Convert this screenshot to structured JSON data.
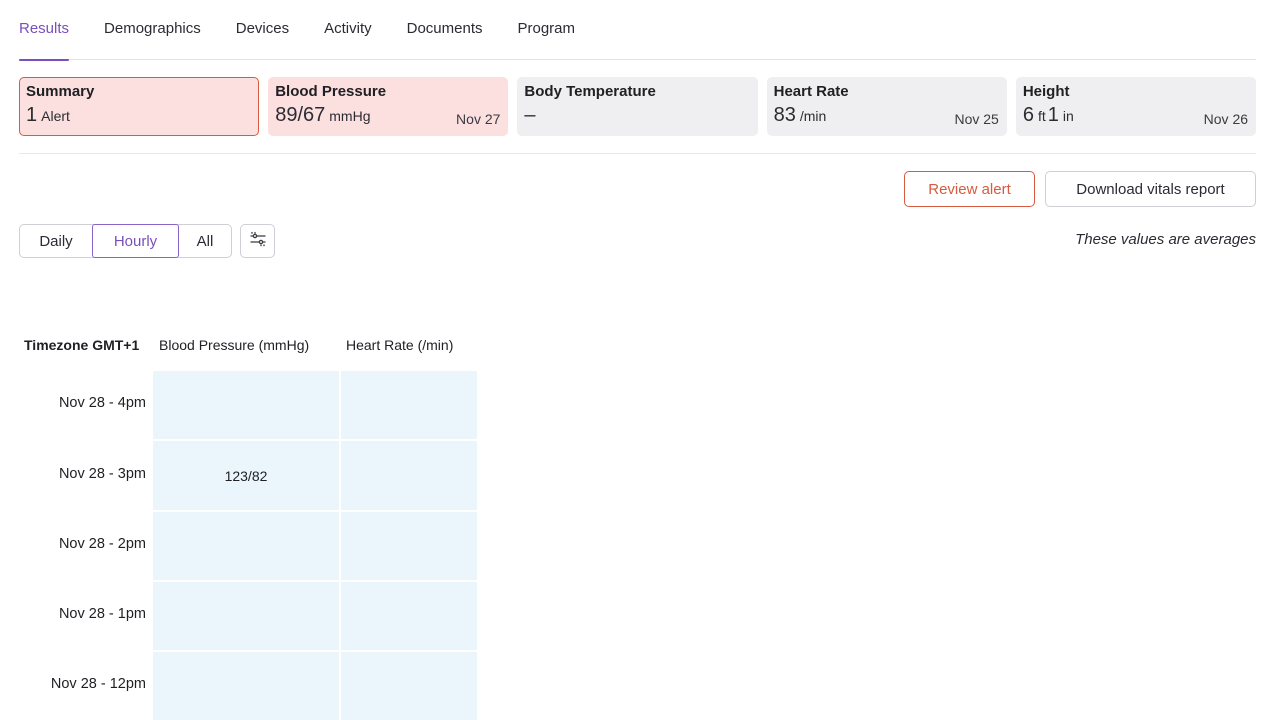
{
  "tabs": [
    "Results",
    "Demographics",
    "Devices",
    "Activity",
    "Documents",
    "Program"
  ],
  "active_tab": "Results",
  "cards": {
    "summary": {
      "title": "Summary",
      "value": "1",
      "unit": "Alert"
    },
    "blood_pressure": {
      "title": "Blood Pressure",
      "value": "89/67",
      "unit": "mmHg",
      "date": "Nov 27"
    },
    "body_temperature": {
      "title": "Body Temperature",
      "value": "–"
    },
    "heart_rate": {
      "title": "Heart Rate",
      "value": "83",
      "unit": "/min",
      "date": "Nov 25"
    },
    "height": {
      "title": "Height",
      "value_ft": "6",
      "unit_ft": "ft",
      "value_in": "1",
      "unit_in": "in",
      "date": "Nov 26"
    }
  },
  "actions": {
    "review": "Review alert",
    "download": "Download vitals report"
  },
  "segments": {
    "daily": "Daily",
    "hourly": "Hourly",
    "all": "All",
    "selected": "Hourly"
  },
  "filter_icon": "sliders-icon",
  "note": "These values are averages",
  "table": {
    "headers": {
      "timezone": "Timezone GMT+1",
      "bp": "Blood Pressure (mmHg)",
      "hr": "Heart Rate (/min)"
    },
    "rows": [
      {
        "label": "Nov 28 - 4pm",
        "bp": "",
        "hr": ""
      },
      {
        "label": "Nov 28 - 3pm",
        "bp": "123/82",
        "hr": ""
      },
      {
        "label": "Nov 28 - 2pm",
        "bp": "",
        "hr": ""
      },
      {
        "label": "Nov 28 - 1pm",
        "bp": "",
        "hr": ""
      },
      {
        "label": "Nov 28 - 12pm",
        "bp": "",
        "hr": ""
      }
    ]
  },
  "colors": {
    "accent": "#7a4fbd",
    "alert": "#d65b3f",
    "alert_bg": "#fbe0df",
    "cell_bg": "#eaf6fb"
  }
}
